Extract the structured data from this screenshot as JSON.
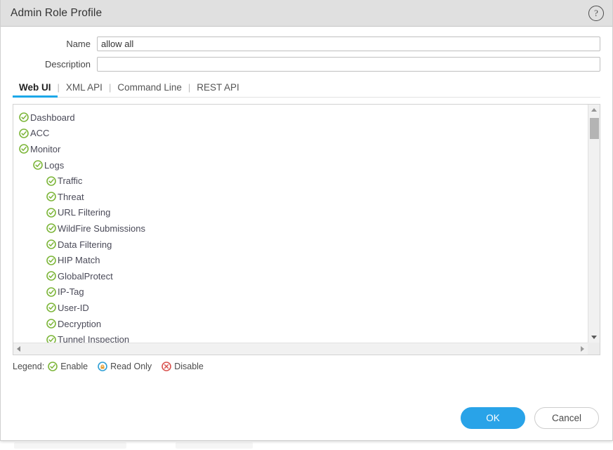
{
  "window": {
    "title": "Admin Role Profile",
    "help_icon": "help-circle-icon",
    "help_glyph": "?"
  },
  "form": {
    "name": {
      "label": "Name",
      "value": "allow all",
      "placeholder": ""
    },
    "description": {
      "label": "Description",
      "value": "",
      "placeholder": ""
    }
  },
  "tabs": [
    {
      "label": "Web UI",
      "active": true
    },
    {
      "label": "XML API",
      "active": false
    },
    {
      "label": "Command Line",
      "active": false
    },
    {
      "label": "REST API",
      "active": false
    }
  ],
  "tab_separator": "|",
  "tree": {
    "items": [
      {
        "label": "Dashboard",
        "level": 0,
        "state": "enable"
      },
      {
        "label": "ACC",
        "level": 0,
        "state": "enable"
      },
      {
        "label": "Monitor",
        "level": 0,
        "state": "enable"
      },
      {
        "label": "Logs",
        "level": 1,
        "state": "enable"
      },
      {
        "label": "Traffic",
        "level": 2,
        "state": "enable"
      },
      {
        "label": "Threat",
        "level": 2,
        "state": "enable"
      },
      {
        "label": "URL Filtering",
        "level": 2,
        "state": "enable"
      },
      {
        "label": "WildFire Submissions",
        "level": 2,
        "state": "enable"
      },
      {
        "label": "Data Filtering",
        "level": 2,
        "state": "enable"
      },
      {
        "label": "HIP Match",
        "level": 2,
        "state": "enable"
      },
      {
        "label": "GlobalProtect",
        "level": 2,
        "state": "enable"
      },
      {
        "label": "IP-Tag",
        "level": 2,
        "state": "enable"
      },
      {
        "label": "User-ID",
        "level": 2,
        "state": "enable"
      },
      {
        "label": "Decryption",
        "level": 2,
        "state": "enable"
      },
      {
        "label": "Tunnel Inspection",
        "level": 2,
        "state": "enable"
      }
    ]
  },
  "legend": {
    "label": "Legend:",
    "items": [
      {
        "label": "Enable",
        "icon": "check-circle-icon",
        "color": "#7DB63A"
      },
      {
        "label": "Read Only",
        "icon": "lock-circle-icon",
        "color": "#2F9FD4"
      },
      {
        "label": "Disable",
        "icon": "x-circle-icon",
        "color": "#D9534F"
      }
    ]
  },
  "footer": {
    "ok_label": "OK",
    "cancel_label": "Cancel"
  },
  "colors": {
    "accent_blue": "#29A3E8",
    "tab_underline": "#1CA8E8",
    "enable_green": "#7DB63A",
    "readonly_blue": "#2F9FD4",
    "disable_red": "#D9534F",
    "titlebar_gray": "#E0E0E0"
  }
}
